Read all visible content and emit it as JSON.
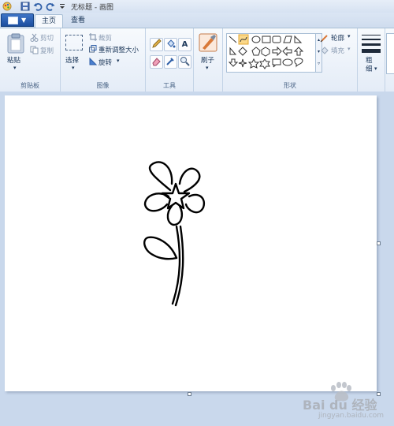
{
  "window": {
    "title": "无标题 - 画图"
  },
  "tabs": [
    {
      "label": "主页",
      "active": true
    },
    {
      "label": "查看",
      "active": false
    }
  ],
  "ribbon": {
    "clipboard": {
      "paste": "粘贴",
      "cut": "剪切",
      "copy": "复制",
      "label": "剪贴板"
    },
    "image": {
      "select": "选择",
      "crop": "裁剪",
      "resize": "重新调整大小",
      "rotate": "旋转",
      "label": "图像"
    },
    "tools": {
      "label": "工具"
    },
    "brushes": {
      "label": "刷子"
    },
    "shapes": {
      "outline": "轮廓",
      "fill": "填充",
      "label": "形状"
    },
    "size": {
      "label": "粗细"
    }
  },
  "watermark": {
    "text": "Bai du 经验",
    "url": "jingyan.baidu.com"
  },
  "colors": {
    "accent": "#1d4e9f",
    "ribbon_bg": "#e4ecf7",
    "workspace": "#c9d8ec",
    "canvas": "#ffffff"
  }
}
